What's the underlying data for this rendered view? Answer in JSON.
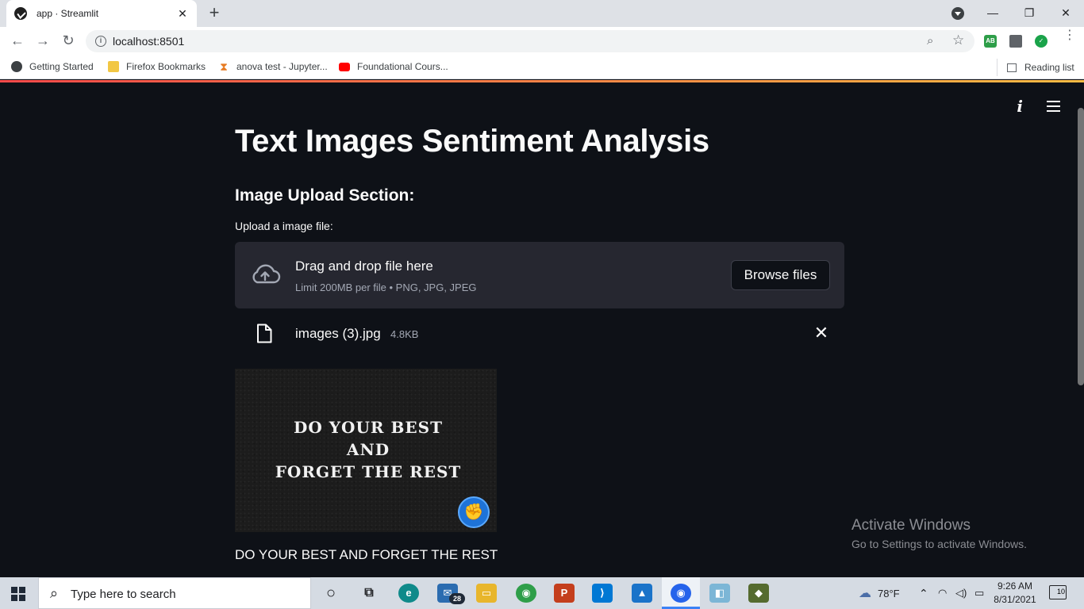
{
  "browser": {
    "tab_title": "app · Streamlit",
    "tab_close": "✕",
    "new_tab": "+",
    "url": "localhost:8501",
    "extensions": [
      {
        "name": "adblock-extension-icon",
        "label": "AB",
        "color": "#2e9e49"
      },
      {
        "name": "puzzle-extension-icon",
        "label": "",
        "color": "#5f6368"
      },
      {
        "name": "shield-extension-icon",
        "label": "✓",
        "color": "#1aa34a"
      }
    ],
    "bookmarks": [
      {
        "label": "Getting Started"
      },
      {
        "label": "Firefox Bookmarks"
      },
      {
        "label": "anova test - Jupyter..."
      },
      {
        "label": "Foundational Cours..."
      }
    ],
    "reading_list": "Reading list"
  },
  "app": {
    "title": "Text Images Sentiment Analysis",
    "section_heading": "Image Upload Section:",
    "uploader": {
      "label": "Upload a image file:",
      "drop_title": "Drag and drop file here",
      "limit": "Limit 200MB per file • PNG, JPG, JPEG",
      "browse_button": "Browse files"
    },
    "uploaded_file": {
      "name": "images (3).jpg",
      "size": "4.8KB",
      "remove": "✕"
    },
    "preview_image": {
      "lines": [
        "DO YOUR BEST",
        "AND",
        "FORGET THE REST"
      ]
    },
    "result_text": "DO YOUR BEST AND FORGET THE REST"
  },
  "watermark": {
    "line1": "Activate Windows",
    "line2": "Go to Settings to activate Windows."
  },
  "taskbar": {
    "search_placeholder": "Type here to search",
    "mail_badge": "28",
    "weather": "78°F",
    "time": "9:26 AM",
    "date": "8/31/2021",
    "notifications": "10"
  }
}
